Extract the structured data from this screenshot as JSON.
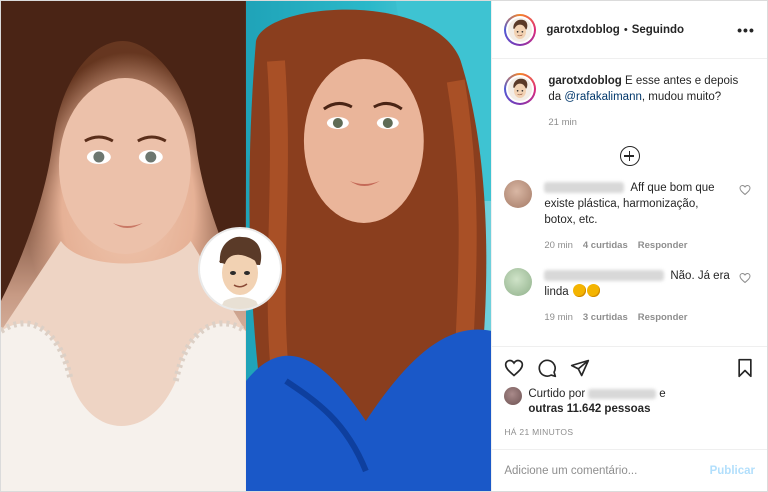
{
  "header": {
    "username": "garotxdoblog",
    "separator": "•",
    "follow_status": "Seguindo",
    "more_label": "•••"
  },
  "caption": {
    "username": "garotxdoblog",
    "text_before": "E esse antes e depois da ",
    "mention": "@rafakalimann",
    "text_after": ", mudou muito?",
    "time": "21 min"
  },
  "comments": [
    {
      "text": "Aff que bom que existe plástica, harmonização, botox, etc.",
      "time": "20 min",
      "likes": "4 curtidas",
      "reply": "Responder"
    },
    {
      "text": "Não. Já era linda",
      "time": "19 min",
      "likes": "3 curtidas",
      "reply": "Responder"
    }
  ],
  "likes": {
    "prefix": "Curtido por",
    "connector": "e",
    "others": "outras 11.642 pessoas"
  },
  "post_time": "HÁ 21 MINUTOS",
  "composer": {
    "placeholder": "Adicione um comentário...",
    "publish_label": "Publicar"
  },
  "icons": {
    "more": "more-icon",
    "load_more": "plus-circle-icon",
    "like": "heart-icon",
    "comment": "comment-icon",
    "share": "share-icon",
    "save": "bookmark-icon"
  },
  "colors": {
    "publish_disabled": "#b2dffc",
    "mention": "#00376b",
    "meta_gray": "#8e8e8e"
  }
}
